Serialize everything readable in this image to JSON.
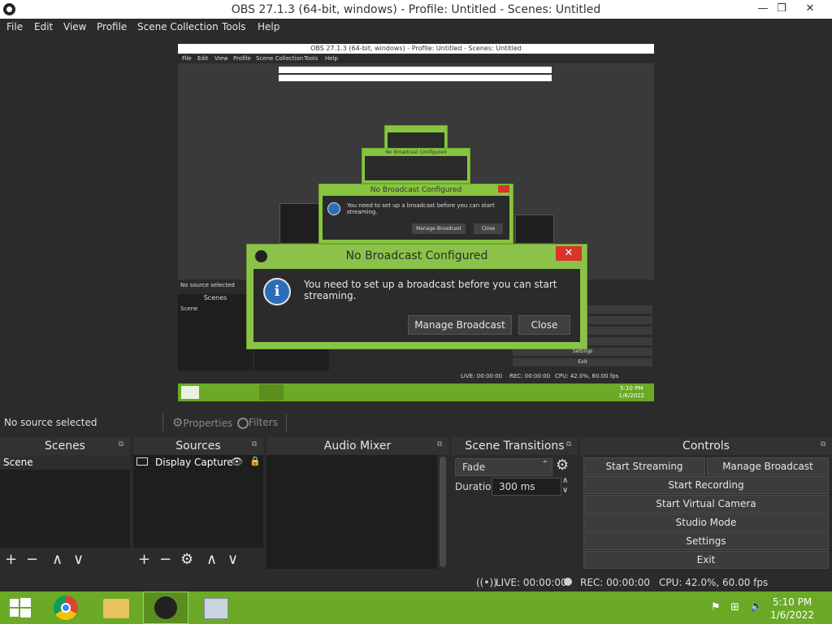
{
  "window": {
    "title": "OBS 27.1.3 (64-bit, windows) - Profile: Untitled - Scenes: Untitled",
    "minimize": "—",
    "maximize": "❐",
    "close": "✕"
  },
  "menu": [
    "File",
    "Edit",
    "View",
    "Profile",
    "Scene Collection",
    "Tools",
    "Help"
  ],
  "preview": {
    "title": "OBS 27.1.3 (64-bit, windows) - Profile: Untitled - Scenes: Untitled",
    "mid_title": "No Broadcast Configured",
    "mid_message": "You need to set up a broadcast before you can start streaming.",
    "mid_manage": "Manage Broadcast",
    "mid_close": "Close",
    "scenes_label": "Scenes",
    "scene_item": "Scene",
    "no_source": "No source selected",
    "status": "LIVE: 00:00:00",
    "rec": "REC: 00:00:00",
    "cpu": "CPU: 42.0%, 60.00 fps",
    "time": "5:10 PM",
    "date": "1/6/2022",
    "settings": "Settings",
    "exit": "Exit"
  },
  "dialog": {
    "title": "No Broadcast Configured",
    "message": "You need to set up a broadcast before you can start streaming.",
    "manage_button": "Manage Broadcast",
    "close_button": "Close",
    "close_x": "✕",
    "info_glyph": "i"
  },
  "toolbar": {
    "no_source": "No source selected",
    "properties": "Properties",
    "filters": "Filters"
  },
  "docks": {
    "scenes": {
      "title": "Scenes",
      "items": [
        "Scene"
      ]
    },
    "sources": {
      "title": "Sources",
      "items": [
        "Display Capture"
      ]
    },
    "audio": {
      "title": "Audio Mixer"
    },
    "transitions": {
      "title": "Scene Transitions",
      "selected": "Fade",
      "duration_label": "Duration",
      "duration_value": "300 ms"
    },
    "controls": {
      "title": "Controls",
      "start_streaming": "Start Streaming",
      "manage_broadcast": "Manage Broadcast",
      "start_recording": "Start Recording",
      "start_virtual_camera": "Start Virtual Camera",
      "studio_mode": "Studio Mode",
      "settings": "Settings",
      "exit": "Exit"
    }
  },
  "status": {
    "live": "LIVE: 00:00:00",
    "rec": "REC: 00:00:00",
    "cpu": "CPU: 42.0%, 60.00 fps"
  },
  "taskbar": {
    "time": "5:10 PM",
    "date": "1/6/2022"
  },
  "icons": {
    "plus": "+",
    "minus": "−",
    "gear": "⚙",
    "up": "∧",
    "down": "∨",
    "eye": "👁",
    "lock": "🔒",
    "popout": "⧉"
  }
}
